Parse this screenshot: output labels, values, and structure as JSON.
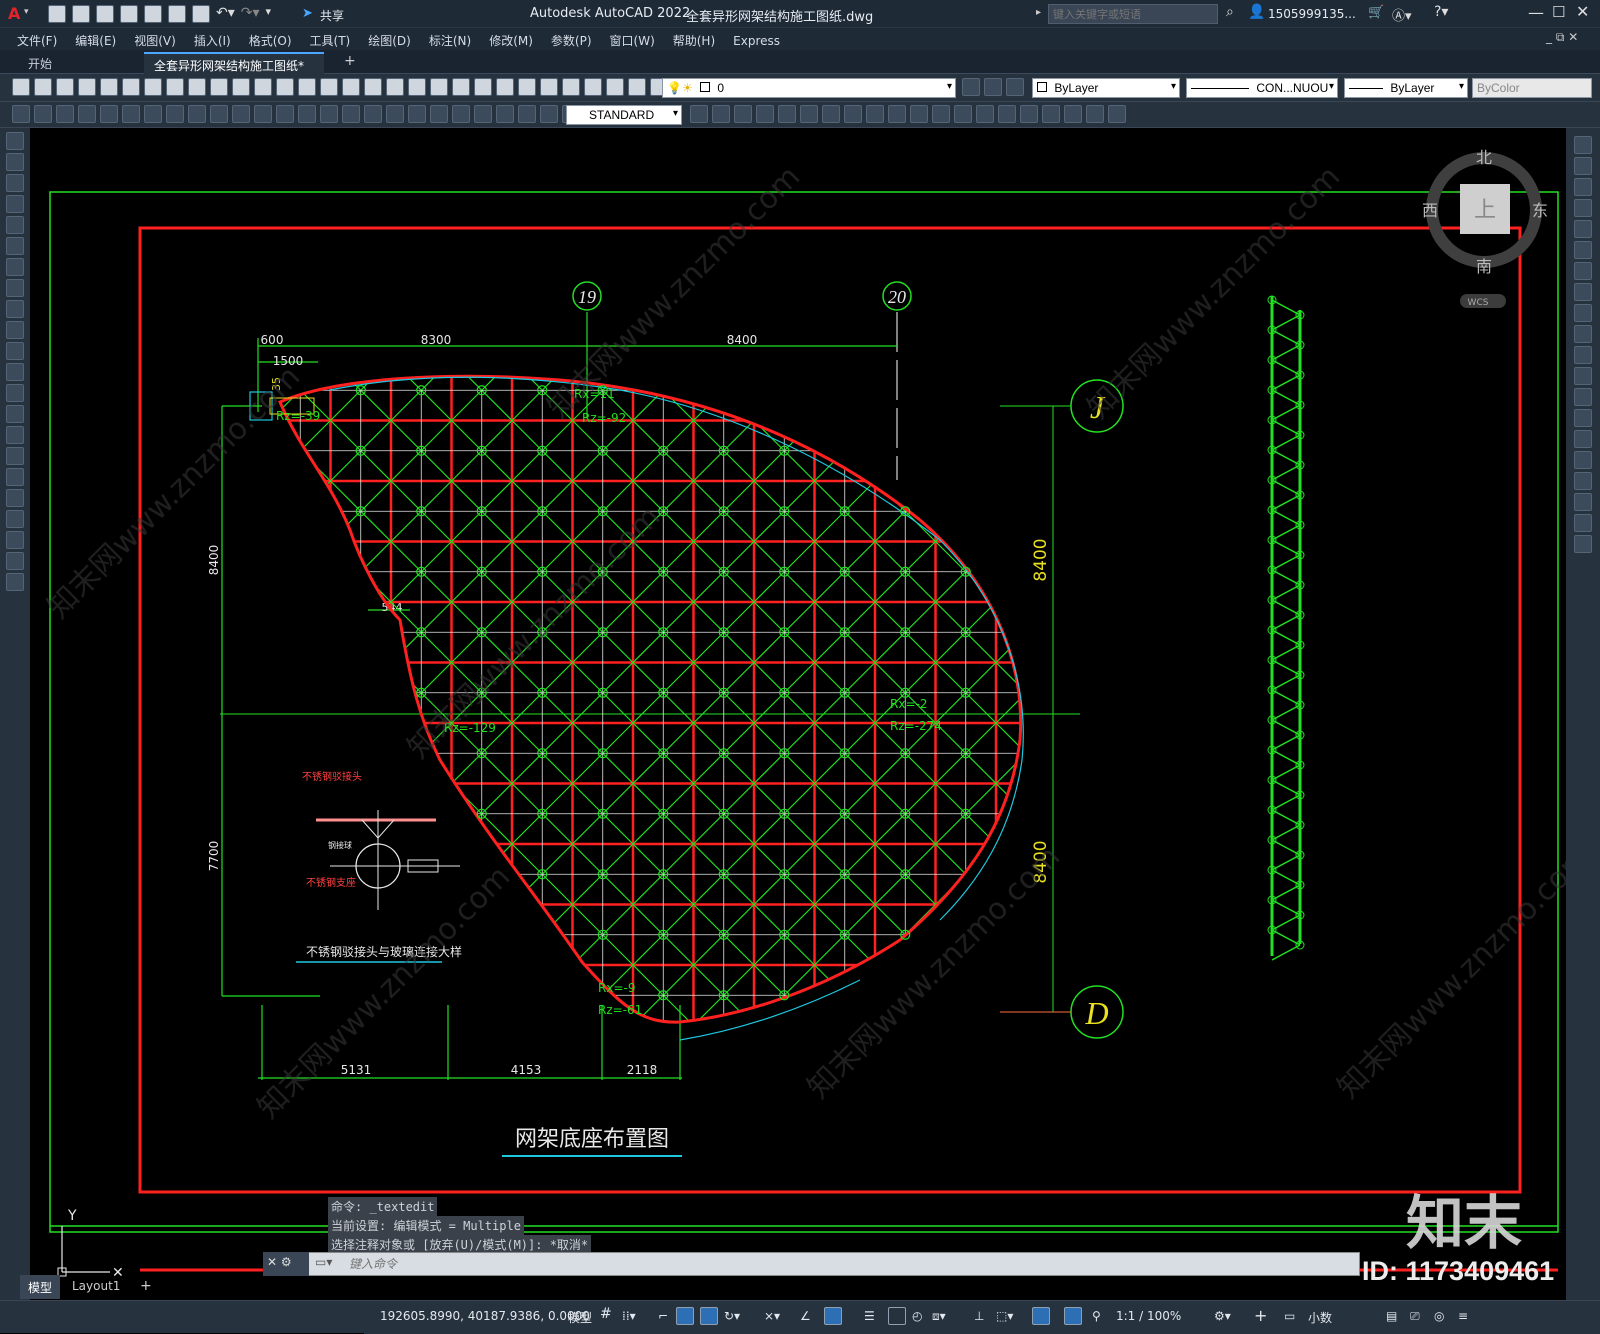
{
  "app": {
    "logo": "A",
    "title": "Autodesk AutoCAD 2022",
    "filename": "全套异形网架结构施工图纸.dwg",
    "search_placeholder": "键入关键字或短语",
    "user": "1505999135...",
    "share_label": "共享"
  },
  "menu": [
    "文件(F)",
    "编辑(E)",
    "视图(V)",
    "插入(I)",
    "格式(O)",
    "工具(T)",
    "绘图(D)",
    "标注(N)",
    "修改(M)",
    "参数(P)",
    "窗口(W)",
    "帮助(H)",
    "Express"
  ],
  "tabs": {
    "start": "开始",
    "doc": "全套异形网架结构施工图纸*",
    "add": "+"
  },
  "toolbar": {
    "layer_value": "0",
    "color_value": "ByLayer",
    "linetype_value": "CON...NUOU",
    "lineweight_value": "ByLayer",
    "plotstyle_value": "ByColor",
    "textstyle_value": "STANDARD"
  },
  "viewcube": {
    "north": "北",
    "south": "南",
    "east": "东",
    "west": "西",
    "top": "上",
    "wcs": "WCS"
  },
  "drawing": {
    "grid_19": "19",
    "grid_20": "20",
    "grid_J": "J",
    "grid_D": "D",
    "dim_600": "600",
    "dim_8300": "8300",
    "dim_8400_top": "8400",
    "dim_1500": "1500",
    "dim_35": "35",
    "dim_left_8400": "8400",
    "dim_left_7700": "7700",
    "dim_right_8400a": "8400",
    "dim_right_8400b": "8400",
    "dim_5131": "5131",
    "dim_4153": "4153",
    "dim_2118": "2118",
    "dim_544": "544",
    "r1": "Rz=-39",
    "r2": "Rx=11",
    "r3": "Rz=-92",
    "r4": "Rx=-2",
    "r5": "Rz=-274",
    "r6": "Rz=-129",
    "r7": "Rx=-9",
    "r8": "Rz=-61",
    "detail_label1": "不锈钢驳接头",
    "detail_label2": "不锈钢支座",
    "detail_label3": "钢接球",
    "detail_title": "不锈钢驳接头与玻璃连接大样",
    "main_title": "网架底座布置图",
    "ucs_y": "Y"
  },
  "command": {
    "line1": "命令: _textedit",
    "line2": "当前设置: 编辑模式 = Multiple",
    "line3": "选择注释对象或 [放弃(U)/模式(M)]: *取消*",
    "prompt_placeholder": "键入命令"
  },
  "status": {
    "model_tab": "模型",
    "layout_tab": "Layout1",
    "coords": "192605.8990, 40187.9386, 0.0000",
    "space": "模型",
    "scale": "1:1 / 100%",
    "units": "小数"
  },
  "watermark": {
    "brand": "知末",
    "id": "ID: 1173409461",
    "site": "知末网www.znzmo.com"
  },
  "colors": {
    "red": "#ff2020",
    "green": "#22e022",
    "cyan": "#1fc8e0",
    "yellow": "#e8e020",
    "white": "#e8e8e8"
  }
}
